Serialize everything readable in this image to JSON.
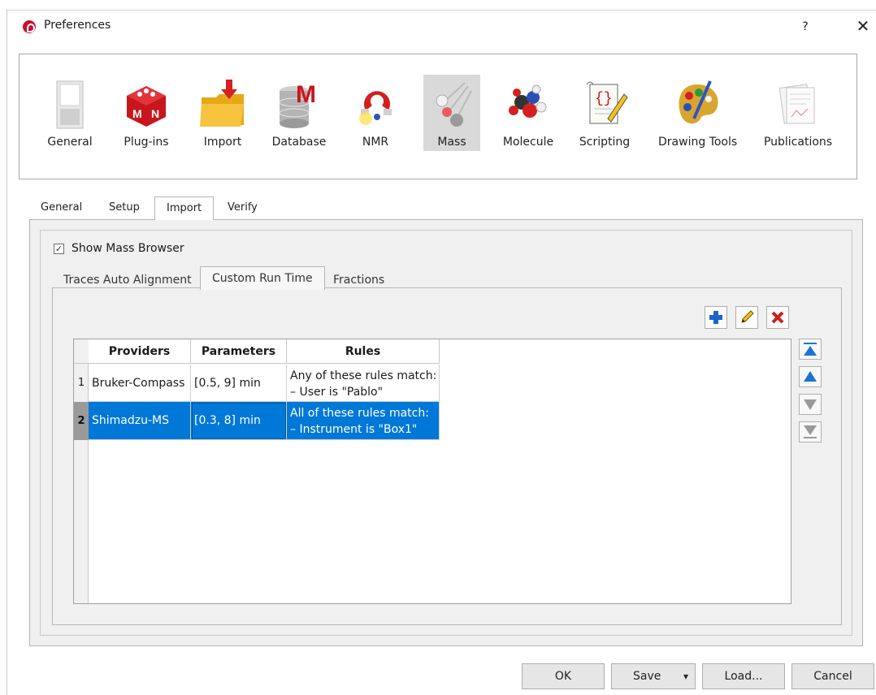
{
  "window": {
    "title": "Preferences",
    "help": "?",
    "close": "✕"
  },
  "categories": [
    {
      "label": "General",
      "icon": "switch-icon"
    },
    {
      "label": "Plug-ins",
      "icon": "plugin-cube-icon"
    },
    {
      "label": "Import",
      "icon": "import-folder-icon"
    },
    {
      "label": "Database",
      "icon": "database-icon"
    },
    {
      "label": "NMR",
      "icon": "nmr-magnet-icon"
    },
    {
      "label": "Mass",
      "icon": "mass-icon",
      "selected": true
    },
    {
      "label": "Molecule",
      "icon": "molecule-icon"
    },
    {
      "label": "Scripting",
      "icon": "scripting-icon"
    },
    {
      "label": "Drawing Tools",
      "icon": "palette-icon"
    },
    {
      "label": "Publications",
      "icon": "publications-icon"
    }
  ],
  "main_tabs": [
    "General",
    "Setup",
    "Import",
    "Verify"
  ],
  "main_tab_active": "Import",
  "show_mass_browser": {
    "label": "Show Mass Browser",
    "checked": true,
    "check_glyph": "✓"
  },
  "sub_tabs": [
    "Traces Auto Alignment",
    "Custom Run Time",
    "Fractions"
  ],
  "sub_tab_active": "Custom Run Time",
  "table": {
    "columns": [
      "Providers",
      "Parameters",
      "Rules"
    ],
    "rows": [
      {
        "num": "1",
        "provider": "Bruker-Compass",
        "parameters": "[0.5, 9] min",
        "rules_line1": "Any of these rules match:",
        "rules_line2": "– User is \"Pablo\"",
        "selected": false
      },
      {
        "num": "2",
        "provider": "Shimadzu-MS",
        "parameters": "[0.3, 8] min",
        "rules_line1": "All of these rules match:",
        "rules_line2": "– Instrument is \"Box1\"",
        "selected": true
      }
    ]
  },
  "actions": {
    "add": "add-icon",
    "edit": "pencil-icon",
    "delete": "delete-icon"
  },
  "footer": {
    "ok": "OK",
    "save": "Save",
    "save_arrow": "▾",
    "load": "Load...",
    "cancel": "Cancel"
  },
  "colors": {
    "selection": "#0078d7",
    "nav_arrow": "#1e73d8",
    "delete": "#cc1f1f",
    "add": "#1c64c8"
  }
}
